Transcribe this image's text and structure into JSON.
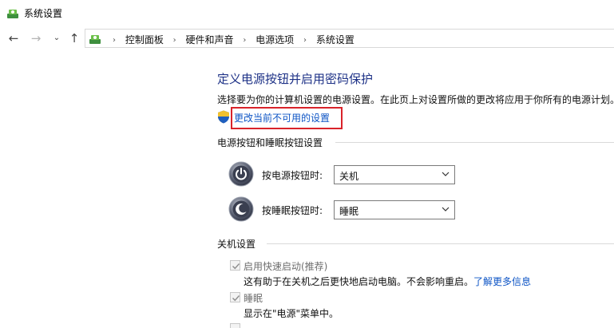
{
  "window": {
    "title": "系统设置"
  },
  "nav": {
    "back": "←",
    "forward": "→",
    "recent": "⌄",
    "up": "↑"
  },
  "breadcrumbs": [
    "控制面板",
    "硬件和声音",
    "电源选项",
    "系统设置"
  ],
  "breadcrumb_separator": "›",
  "main": {
    "title": "定义电源按钮并启用密码保护",
    "description": "选择要为你的计算机设置的电源设置。在此页上对设置所做的更改将应用于你所有的电源计划。",
    "change_settings_link": "更改当前不可用的设置"
  },
  "power_buttons_section": {
    "heading": "电源按钮和睡眠按钮设置",
    "rows": [
      {
        "label": "按电源按钮时:",
        "value": "关机"
      },
      {
        "label": "按睡眠按钮时:",
        "value": "睡眠"
      }
    ]
  },
  "shutdown_section": {
    "heading": "关机设置",
    "options": [
      {
        "label": "启用快速启动(推荐)",
        "checked": true,
        "description": "这有助于在关机之后更快地启动电脑。不会影响重启。",
        "link": "了解更多信息"
      },
      {
        "label": "睡眠",
        "checked": true,
        "description": "显示在\"电源\"菜单中。"
      }
    ]
  },
  "colors": {
    "title": "#1e3287",
    "link": "#0d54c5",
    "highlight_box": "#d9232a",
    "disabled_text": "#6d6d6d"
  }
}
